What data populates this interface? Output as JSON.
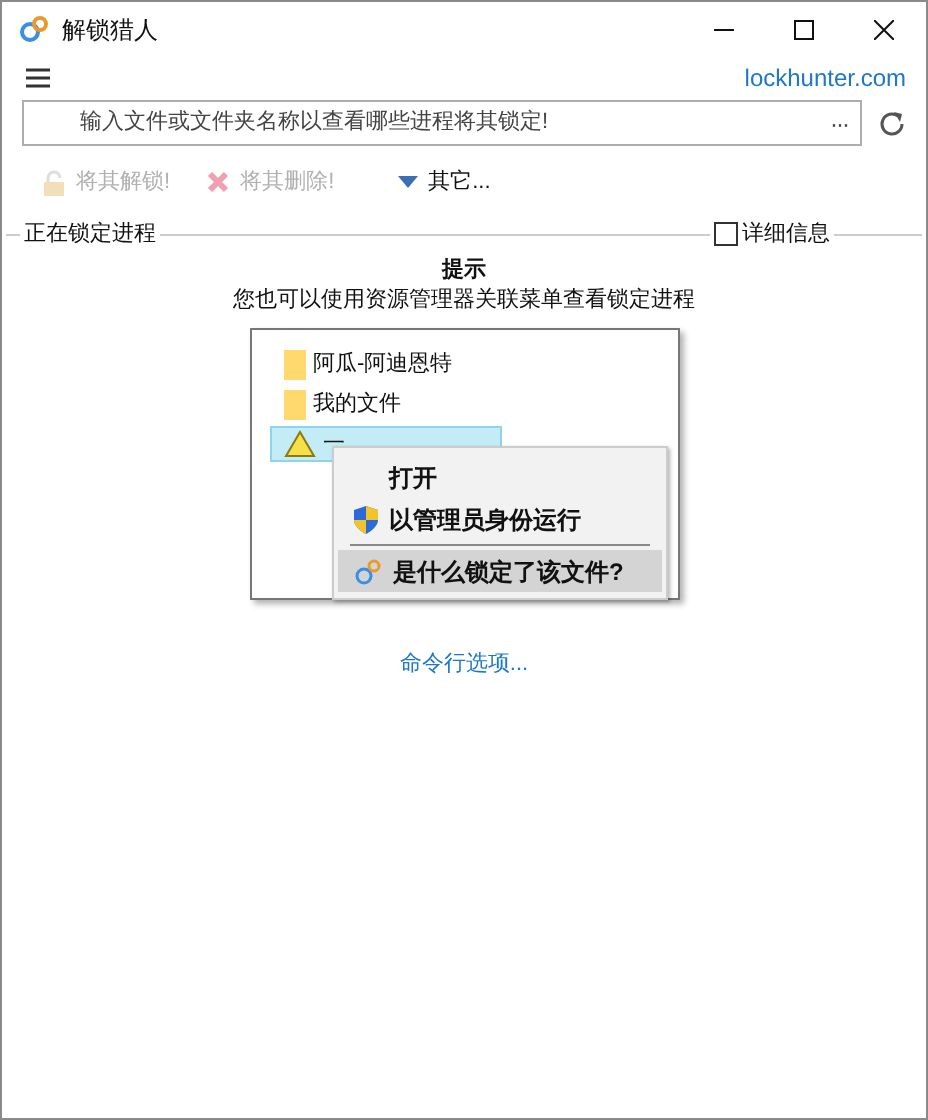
{
  "window": {
    "title": "解锁猎人"
  },
  "header": {
    "link": "lockhunter.com"
  },
  "search": {
    "placeholder": "输入文件或文件夹名称以查看哪些进程将其锁定!",
    "browse": "···"
  },
  "toolbar": [
    {
      "kind": "unlock",
      "label": "将其解锁!",
      "disabled": true
    },
    {
      "kind": "delete",
      "label": "将其删除!",
      "disabled": true
    },
    {
      "kind": "other",
      "label": "其它...",
      "disabled": false
    }
  ],
  "section": {
    "title": "正在锁定进程",
    "details": {
      "label": "详细信息",
      "checked": false
    }
  },
  "hint": {
    "title": "提示",
    "text": "您也可以使用资源管理器关联菜单查看锁定进程",
    "files": [
      {
        "kind": "folder",
        "name": "阿瓜-阿迪恩特",
        "selected": false
      },
      {
        "kind": "folder",
        "name": "我的文件",
        "selected": false
      },
      {
        "kind": "hazard",
        "name": "一",
        "selected": true
      }
    ],
    "menu": [
      {
        "kind": "plain",
        "label": "打开",
        "highlighted": false
      },
      {
        "kind": "shield",
        "label": "以管理员身份运行",
        "highlighted": false
      },
      {
        "kind": "lockhunter",
        "label": "是什么锁定了该文件?",
        "highlighted": true
      }
    ]
  },
  "footer_link": "命令行选项..."
}
